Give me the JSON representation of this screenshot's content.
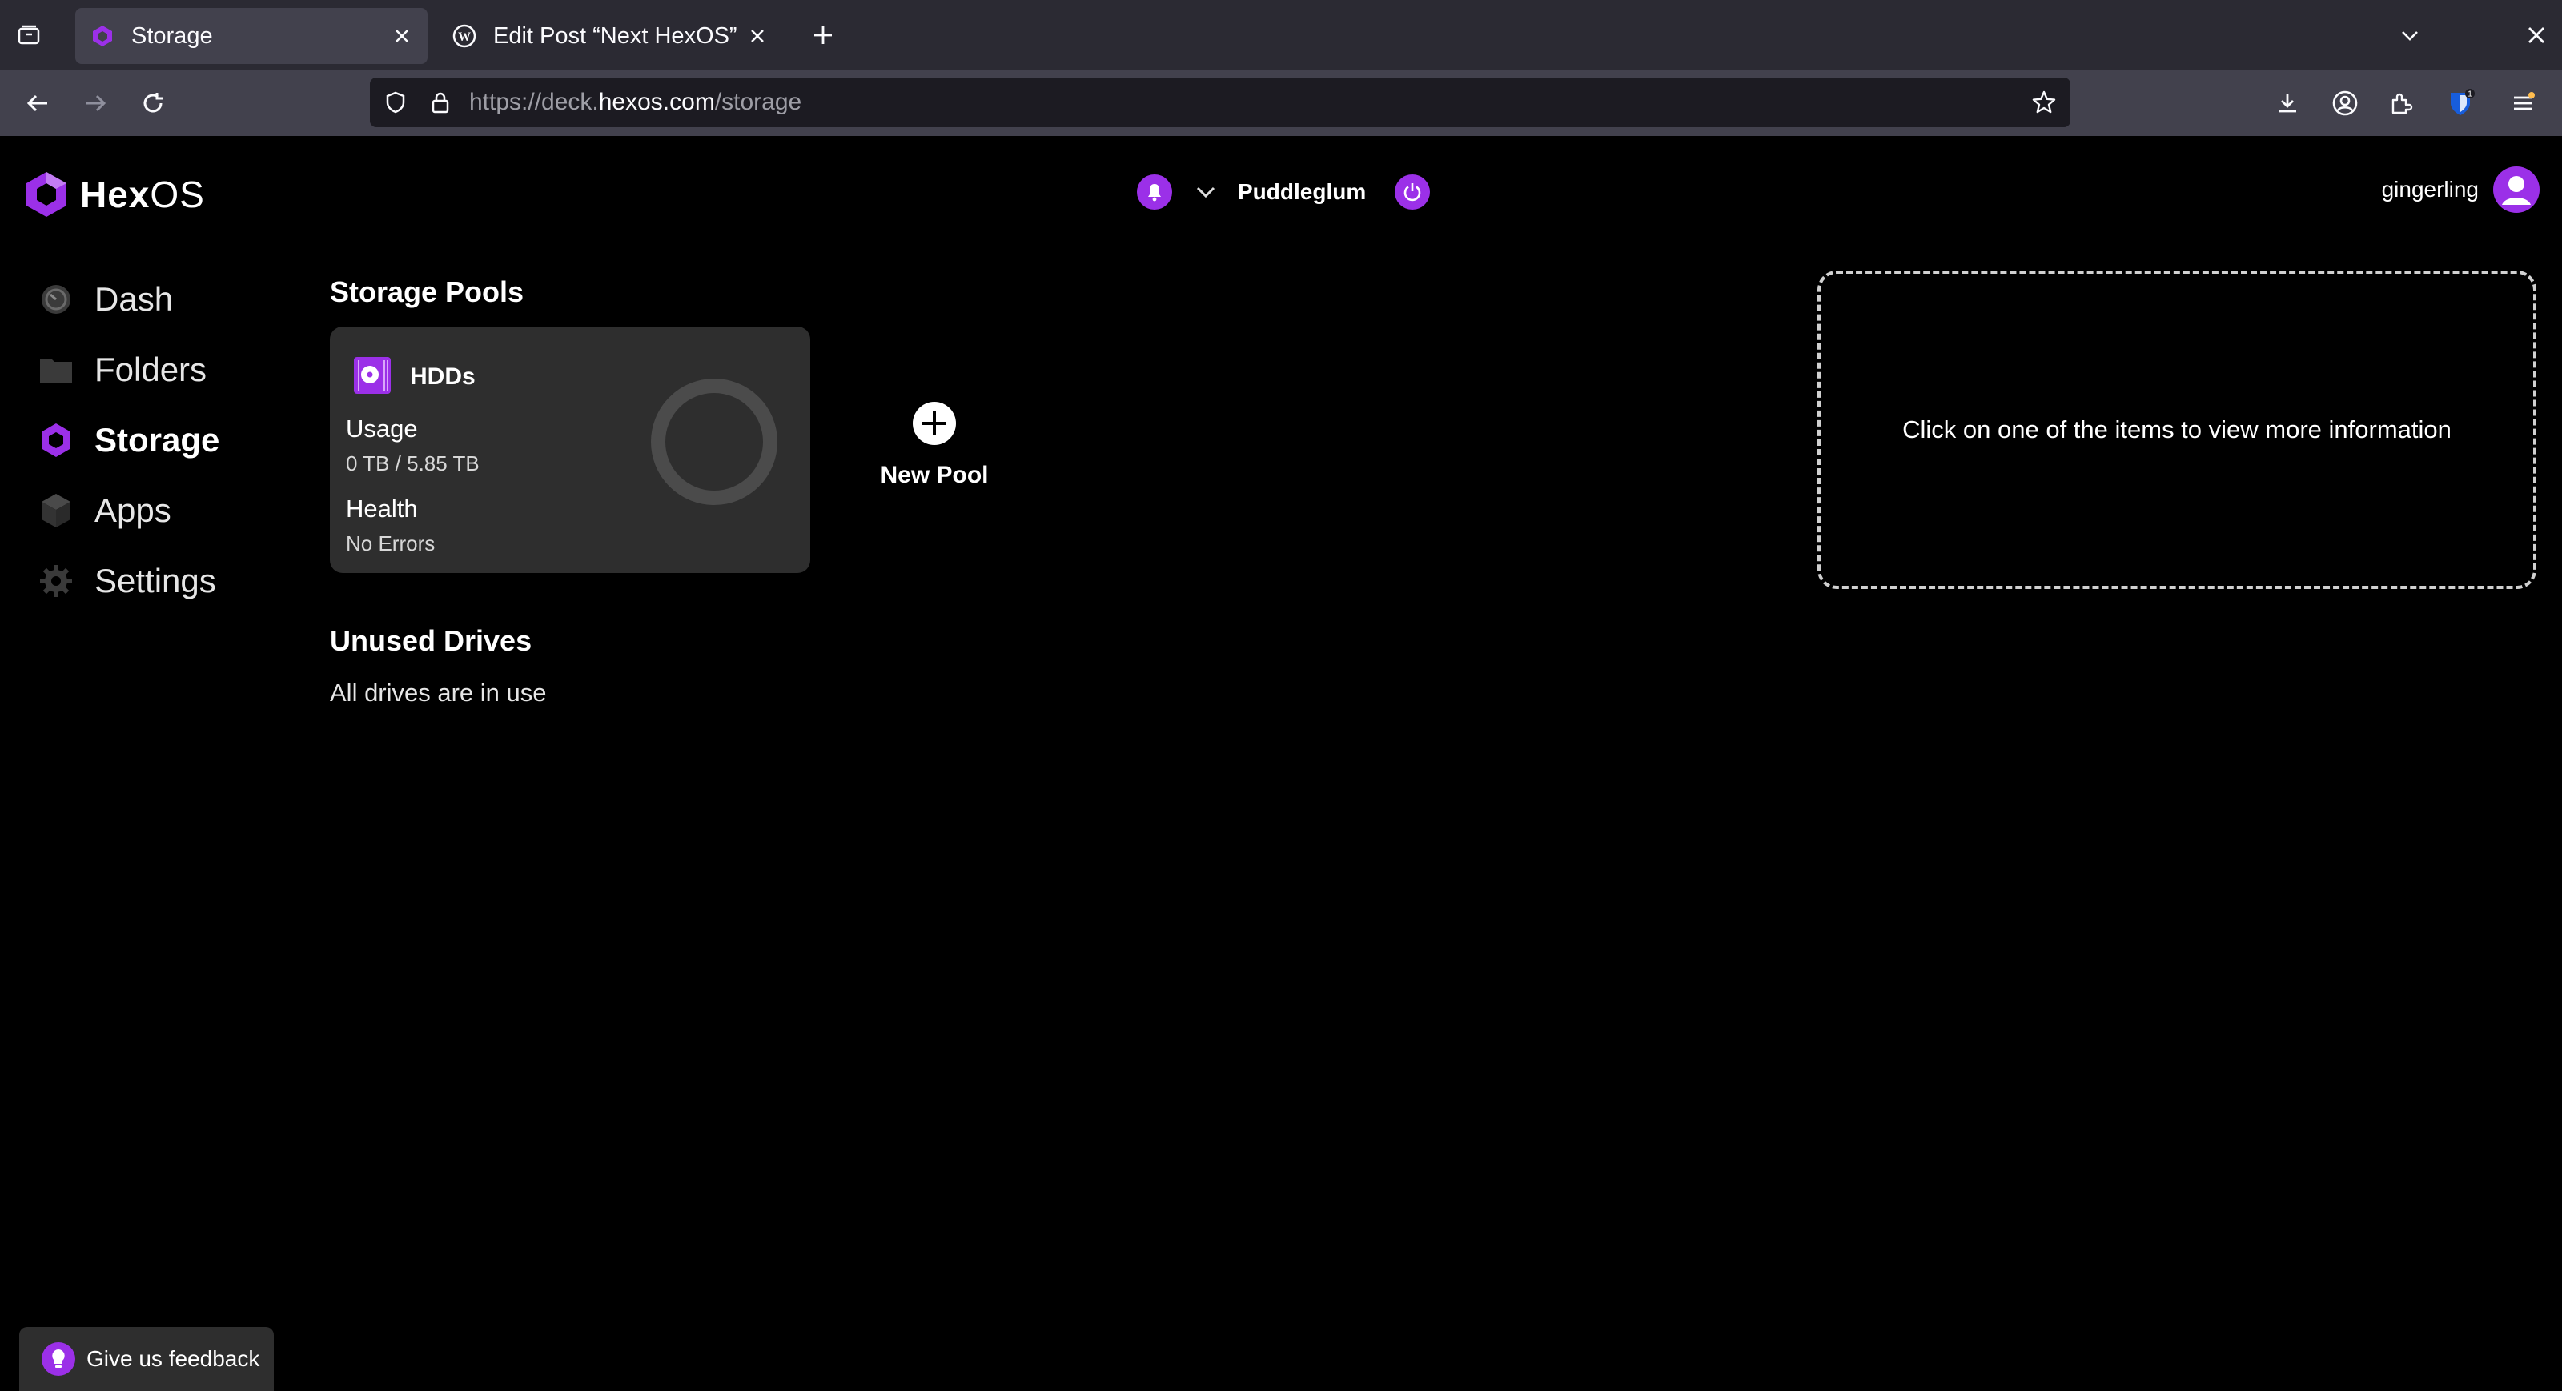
{
  "browser": {
    "tabs": [
      {
        "title": "Storage",
        "active": true
      },
      {
        "title": "Edit Post “Next HexOS” ‹ Al",
        "active": false
      }
    ],
    "url": {
      "scheme_and_sub": "https://deck.",
      "host": "hexos.com",
      "path": "/storage"
    },
    "colors": {
      "tabbar": "#2b2a33",
      "toolbar": "#42414d",
      "urlbar": "#1c1b22"
    }
  },
  "app": {
    "brand": {
      "hex": "Hex",
      "os": "OS"
    },
    "accent": "#9b30e8",
    "server": {
      "name": "Puddleglum"
    },
    "user": {
      "name": "gingerling"
    },
    "sidebar": {
      "items": [
        {
          "label": "Dash",
          "icon": "dashboard-gauge-icon",
          "active": false
        },
        {
          "label": "Folders",
          "icon": "folder-icon",
          "active": false
        },
        {
          "label": "Storage",
          "icon": "hexagon-icon",
          "active": true
        },
        {
          "label": "Apps",
          "icon": "cube-icon",
          "active": false
        },
        {
          "label": "Settings",
          "icon": "gear-icon",
          "active": false
        }
      ]
    },
    "storage": {
      "pools_title": "Storage Pools",
      "pools": [
        {
          "name": "HDDs",
          "usage_label": "Usage",
          "usage_value": "0 TB / 5.85 TB",
          "usage_fraction": 0,
          "health_label": "Health",
          "health_value": "No Errors"
        }
      ],
      "new_pool_label": "New Pool",
      "unused_title": "Unused Drives",
      "unused_text": "All drives are in use"
    },
    "info_panel": {
      "text": "Click on one of the items to view more information"
    },
    "feedback": {
      "label": "Give us feedback"
    }
  }
}
